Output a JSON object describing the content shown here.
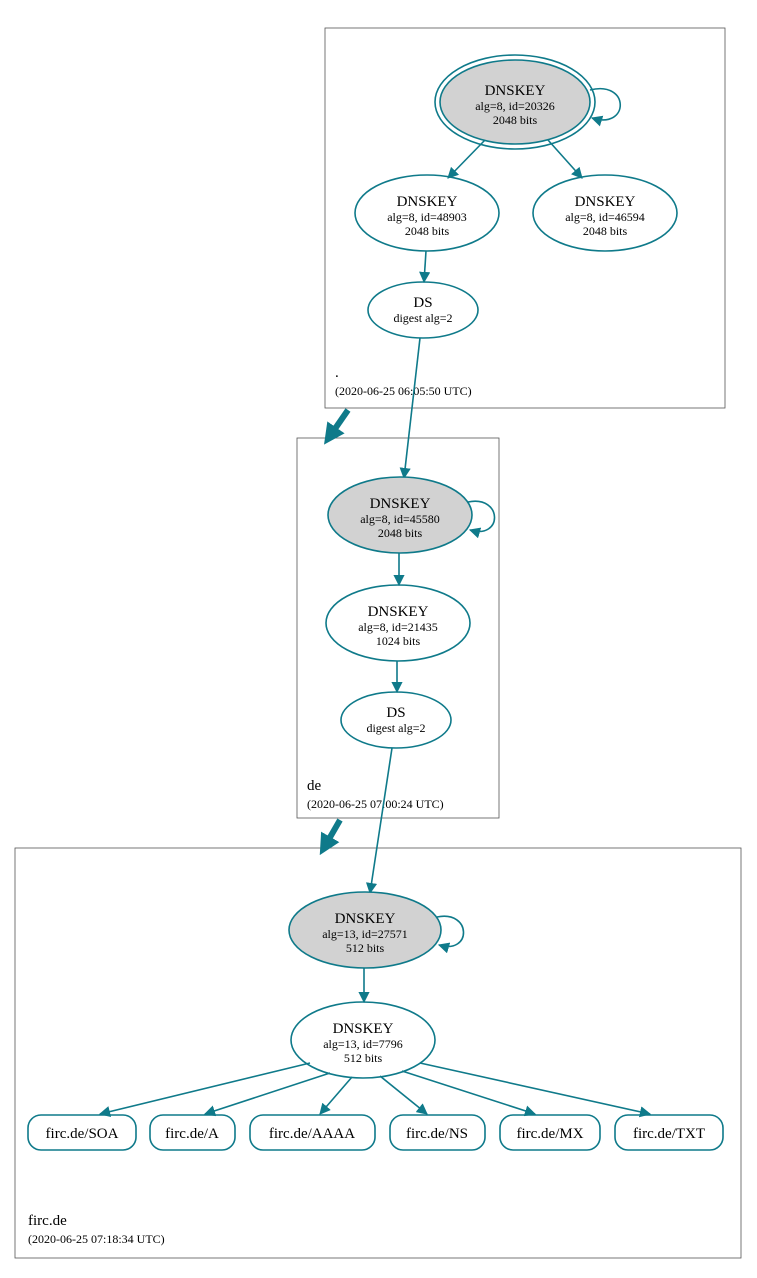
{
  "colors": {
    "accent": "#0f7a8a",
    "ksk_fill": "#d2d2d2"
  },
  "zones": {
    "root": {
      "label": ".",
      "timestamp": "(2020-06-25 06:05:50 UTC)"
    },
    "de": {
      "label": "de",
      "timestamp": "(2020-06-25 07:00:24 UTC)"
    },
    "firc": {
      "label": "firc.de",
      "timestamp": "(2020-06-25 07:18:34 UTC)"
    }
  },
  "nodes": {
    "root_ksk": {
      "title": "DNSKEY",
      "l2": "alg=8, id=20326",
      "l3": "2048 bits"
    },
    "root_zsk1": {
      "title": "DNSKEY",
      "l2": "alg=8, id=48903",
      "l3": "2048 bits"
    },
    "root_zsk2": {
      "title": "DNSKEY",
      "l2": "alg=8, id=46594",
      "l3": "2048 bits"
    },
    "root_ds": {
      "title": "DS",
      "l2": "digest alg=2"
    },
    "de_ksk": {
      "title": "DNSKEY",
      "l2": "alg=8, id=45580",
      "l3": "2048 bits"
    },
    "de_zsk": {
      "title": "DNSKEY",
      "l2": "alg=8, id=21435",
      "l3": "1024 bits"
    },
    "de_ds": {
      "title": "DS",
      "l2": "digest alg=2"
    },
    "firc_ksk": {
      "title": "DNSKEY",
      "l2": "alg=13, id=27571",
      "l3": "512 bits"
    },
    "firc_zsk": {
      "title": "DNSKEY",
      "l2": "alg=13, id=7796",
      "l3": "512 bits"
    }
  },
  "leaves": {
    "soa": "firc.de/SOA",
    "a": "firc.de/A",
    "aaaa": "firc.de/AAAA",
    "ns": "firc.de/NS",
    "mx": "firc.de/MX",
    "txt": "firc.de/TXT"
  }
}
